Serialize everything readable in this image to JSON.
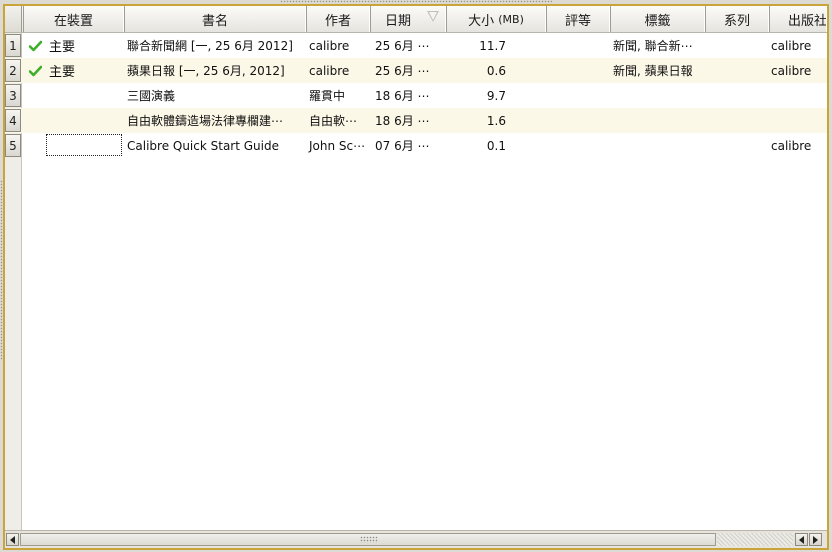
{
  "columns": {
    "on_device": "在裝置",
    "title": "書名",
    "author": "作者",
    "date": "日期",
    "size": "大小",
    "size_unit": "(MB)",
    "rating": "評等",
    "tags": "標籤",
    "series": "系列",
    "publisher": "出版社"
  },
  "sort": {
    "column": "date",
    "direction": "descending"
  },
  "rows": [
    {
      "num": "1",
      "on_device": "主要",
      "on_device_check": true,
      "title": "聯合新聞網 [一, 25 6月 2012]",
      "author": "calibre",
      "date": "25  6月 ⋯",
      "size": "11.7",
      "rating": "",
      "tags": "新聞, 聯合新⋯",
      "series": "",
      "publisher": "calibre"
    },
    {
      "num": "2",
      "on_device": "主要",
      "on_device_check": true,
      "title": "蘋果日報 [一, 25 6月, 2012]",
      "author": "calibre",
      "date": "25  6月 ⋯",
      "size": "0.6",
      "rating": "",
      "tags": "新聞, 蘋果日報",
      "series": "",
      "publisher": "calibre"
    },
    {
      "num": "3",
      "on_device": "",
      "on_device_check": false,
      "title": "三國演義",
      "author": "羅貫中",
      "date": "18  6月 ⋯",
      "size": "9.7",
      "rating": "",
      "tags": "",
      "series": "",
      "publisher": ""
    },
    {
      "num": "4",
      "on_device": "",
      "on_device_check": false,
      "title": "自由軟體鑄造場法律專欄建⋯",
      "author": "自由軟⋯",
      "date": "18  6月 ⋯",
      "size": "1.6",
      "rating": "",
      "tags": "",
      "series": "",
      "publisher": ""
    },
    {
      "num": "5",
      "on_device": "",
      "on_device_check": false,
      "title": "Calibre Quick Start Guide",
      "author": "John Sc⋯",
      "date": "07  6月 ⋯",
      "size": "0.1",
      "rating": "",
      "tags": "",
      "series": "",
      "publisher": "calibre"
    }
  ],
  "colors": {
    "frame_border": "#c9a43a",
    "alt_row": "#fcf8e7",
    "check": "#3fae2a"
  },
  "icons": {
    "check": "checkmark-icon",
    "sort": "sort-descending-icon",
    "scroll_left": "arrow-left-icon",
    "scroll_right": "arrow-right-icon"
  }
}
